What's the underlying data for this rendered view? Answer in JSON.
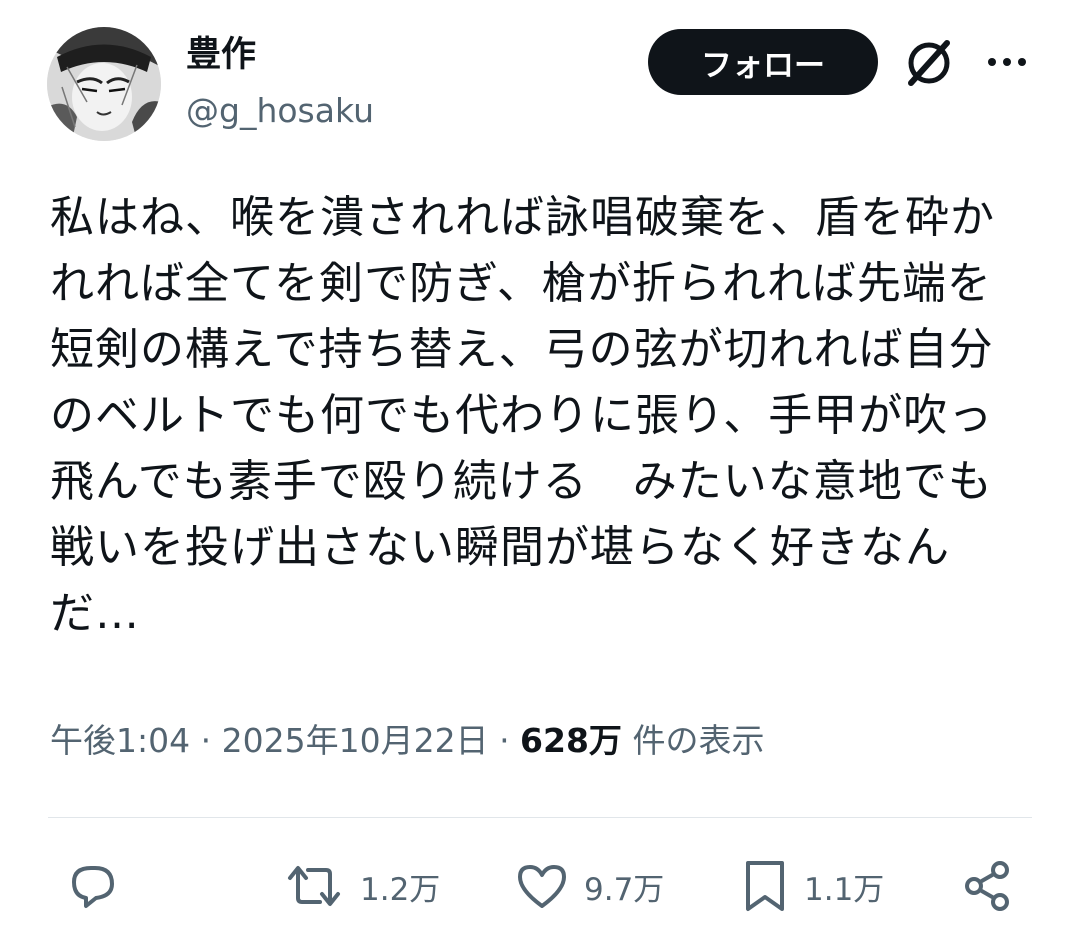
{
  "author": {
    "display_name": "豊作",
    "handle": "@g_hosaku"
  },
  "header": {
    "follow_label": "フォロー",
    "icons": [
      "avatar",
      "grok-icon",
      "more-icon"
    ]
  },
  "tweet": {
    "text": "私はね、喉を潰されれば詠唱破棄を、盾を砕かれれば全てを剣で防ぎ、槍が折られれば先端を短剣の構えで持ち替え、弓の弦が切れれば自分のベルトでも何でも代わりに張り、手甲が吹っ飛んでも素手で殴り続ける　みたいな意地でも戦いを投げ出さない瞬間が堪らなく好きなんだ…",
    "time": "午後1:04",
    "date": "2025年10月22日",
    "views_count": "628万",
    "views_label": "件の表示"
  },
  "actions": {
    "reply": {
      "icon": "reply-icon"
    },
    "retweet": {
      "icon": "retweet-icon",
      "count": "1.2万"
    },
    "like": {
      "icon": "heart-icon",
      "count": "9.7万"
    },
    "bookmark": {
      "icon": "bookmark-icon",
      "count": "1.1万"
    },
    "share": {
      "icon": "share-icon"
    }
  },
  "colors": {
    "text_primary": "#0f1419",
    "text_secondary": "#536471",
    "follow_bg": "#0f1419",
    "divider": "#e1e6ea"
  }
}
